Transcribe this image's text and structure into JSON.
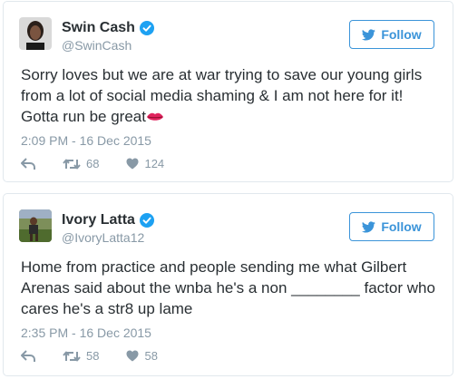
{
  "tweets": [
    {
      "name": "Swin Cash",
      "handle": "@SwinCash",
      "follow_label": "Follow",
      "text": "Sorry loves but we are at war trying to save our young girls from a lot of social media shaming & I am not here for it! Gotta run be great",
      "timestamp": "2:09 PM - 16 Dec 2015",
      "retweets": "68",
      "likes": "124"
    },
    {
      "name": "Ivory Latta",
      "handle": "@IvoryLatta12",
      "follow_label": "Follow",
      "text": "Home from practice and people sending me what Gilbert Arenas said about the wnba he's a non ________ factor who cares he's a str8 up lame",
      "timestamp": "2:35 PM - 16 Dec 2015",
      "retweets": "58",
      "likes": "58"
    }
  ],
  "icons": {
    "verified": "verified-badge-icon",
    "bird": "twitter-bird-icon",
    "reply": "reply-icon",
    "retweet": "retweet-icon",
    "like": "heart-icon",
    "emoji": "kiss-mark-emoji"
  },
  "colors": {
    "accent": "#3b94d9",
    "verified": "#1da1f2",
    "muted": "#8899a6",
    "text": "#292f33",
    "border": "#e1e8ed"
  }
}
